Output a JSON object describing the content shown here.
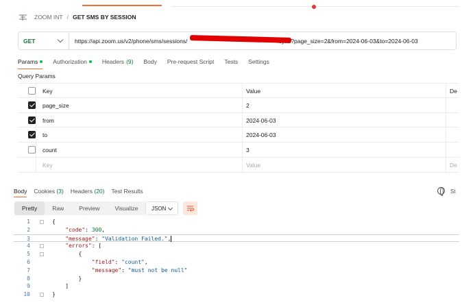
{
  "breadcrumb": {
    "workspace": "ZOOM INT",
    "separator": "/",
    "request": "GET SMS BY SESSION"
  },
  "request": {
    "method": "GET",
    "url_prefix": "https://api.zoom.us/v2/phone/sms/sessions/",
    "url_suffix": "/sync?page_size=2&from=2024-06-03&to=2024-06-03"
  },
  "request_tabs": [
    {
      "label": "Params",
      "dot": true
    },
    {
      "label": "Authorization",
      "dot": true
    },
    {
      "label": "Headers",
      "count": "(9)"
    },
    {
      "label": "Body"
    },
    {
      "label": "Pre-request Script"
    },
    {
      "label": "Tests"
    },
    {
      "label": "Settings"
    }
  ],
  "query_params_title": "Query Params",
  "params_table": {
    "headers": {
      "key": "Key",
      "value": "Value",
      "description": "De"
    },
    "rows": [
      {
        "checked": true,
        "key": "page_size",
        "value": "2"
      },
      {
        "checked": true,
        "key": "from",
        "value": "2024-06-03"
      },
      {
        "checked": true,
        "key": "to",
        "value": "2024-06-03"
      },
      {
        "checked": false,
        "key": "count",
        "value": "3"
      }
    ],
    "placeholder": {
      "key": "Key",
      "value": "Value",
      "description": "De"
    }
  },
  "response_tabs": [
    {
      "label": "Body"
    },
    {
      "label": "Cookies",
      "count": "(3)"
    },
    {
      "label": "Headers",
      "count": "(20)"
    },
    {
      "label": "Test Results"
    }
  ],
  "status_label": "St",
  "view_modes": [
    "Pretty",
    "Raw",
    "Preview",
    "Visualize"
  ],
  "format": "JSON",
  "code_lines": [
    {
      "n": "1",
      "html": "{"
    },
    {
      "n": "2",
      "html": "    <span class='key'>\"code\"</span>: <span class='num'>300</span>,"
    },
    {
      "n": "3",
      "html": "    <span class='key'>\"message\"</span>: <span class='str'>\"Validation Failed.\"</span>,"
    },
    {
      "n": "4",
      "html": "    <span class='key'>\"errors\"</span>: ["
    },
    {
      "n": "5",
      "html": "        {"
    },
    {
      "n": "6",
      "html": "            <span class='key'>\"field\"</span>: <span class='str'>\"count\"</span>,"
    },
    {
      "n": "7",
      "html": "            <span class='key'>\"message\"</span>: <span class='str'>\"must not be null\"</span>"
    },
    {
      "n": "8",
      "html": "        }"
    },
    {
      "n": "9",
      "html": "    ]"
    },
    {
      "n": "10",
      "html": "}"
    }
  ],
  "colors": {
    "accent": "#f26b3a",
    "method_get": "#0b7a36",
    "dot": "#0cbb52",
    "redaction": "#e00000"
  }
}
